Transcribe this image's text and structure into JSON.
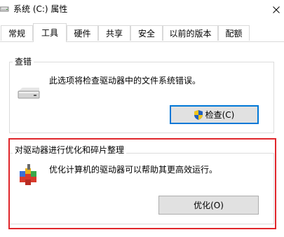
{
  "window": {
    "title": "系统 (C:) 属性",
    "close_icon": "close-icon"
  },
  "tabs": [
    {
      "label": "常规",
      "active": false
    },
    {
      "label": "工具",
      "active": true
    },
    {
      "label": "硬件",
      "active": false
    },
    {
      "label": "共享",
      "active": false
    },
    {
      "label": "安全",
      "active": false
    },
    {
      "label": "以前的版本",
      "active": false
    },
    {
      "label": "配额",
      "active": false
    }
  ],
  "error_check": {
    "group_title": "查错",
    "description": "此选项将检查驱动器中的文件系统错误。",
    "button_label": "检查(C)",
    "icon": "drive-icon",
    "button_icon": "uac-shield-icon"
  },
  "optimize": {
    "group_title": "对驱动器进行优化和碎片整理",
    "description": "优化计算机的驱动器可以帮助其更高效运行。",
    "button_label": "优化(O)",
    "icon": "defrag-icon"
  },
  "colors": {
    "highlight_border": "#e0262b",
    "focus_border": "#0078d7"
  }
}
